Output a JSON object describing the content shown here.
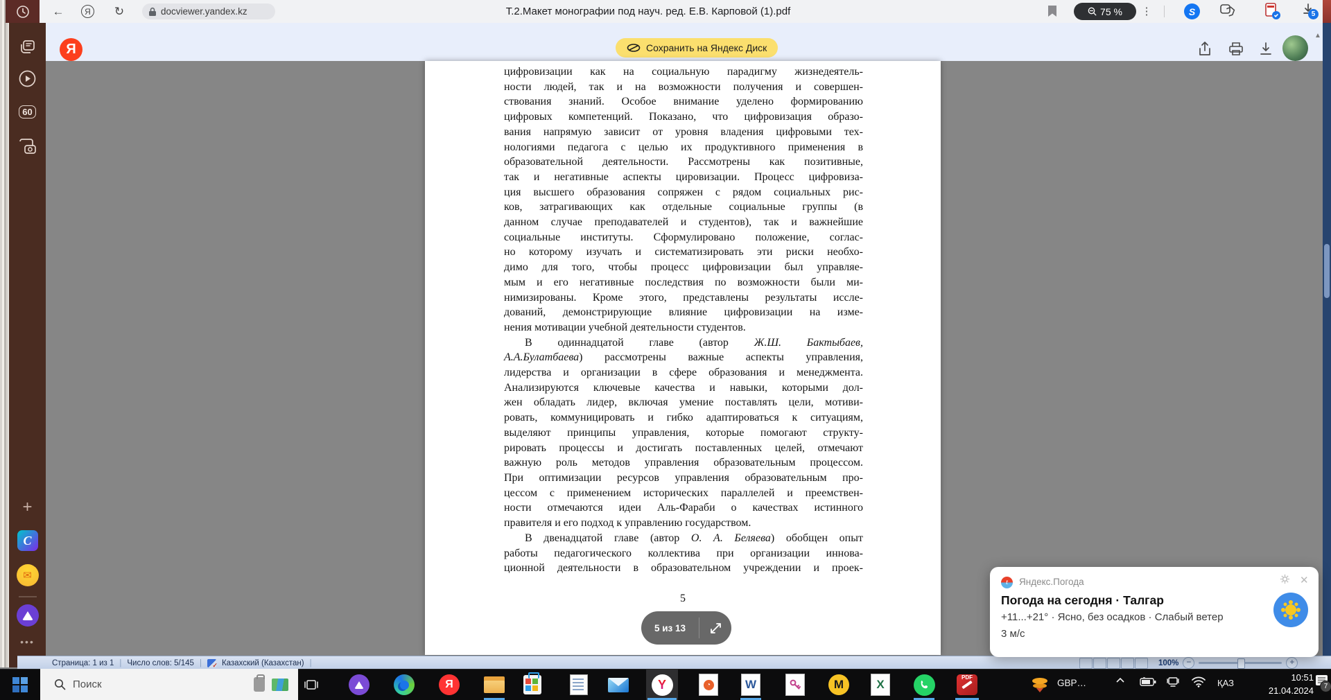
{
  "browser": {
    "url": "docviewer.yandex.kz",
    "title": "Т.2.Макет монографии под науч. ред. Е.В. Карповой (1).pdf",
    "zoom_badge": "75 %",
    "download_badge": "5",
    "accent_yellow": "#fbdf6e",
    "sidebar_brown": "#4a2c21"
  },
  "actions": {
    "save_button": "Сохранить на Яндекс Диск"
  },
  "sidebar": {
    "timer_badge": "60"
  },
  "document": {
    "page_number": "5",
    "pager_label": "5 из 13",
    "lines": [
      {
        "j": true,
        "s": [
          {
            "t": "цифровизации  как на социальную парадигму жизнедеятель-"
          }
        ]
      },
      {
        "j": true,
        "s": [
          {
            "t": "ности людей, так и на возможности получения и совершен-"
          }
        ]
      },
      {
        "j": true,
        "s": [
          {
            "t": "ствования знаний. Особое внимание уделено формированию"
          }
        ]
      },
      {
        "j": true,
        "s": [
          {
            "t": "цифровых компетенций. Показано, что цифровизация образо-"
          }
        ]
      },
      {
        "j": true,
        "s": [
          {
            "t": "вания напрямую зависит от уровня владения цифровыми тех-"
          }
        ]
      },
      {
        "j": true,
        "s": [
          {
            "t": "нологиями педагога с целью их продуктивного применения в"
          }
        ]
      },
      {
        "j": true,
        "s": [
          {
            "t": "образовательной деятельности. Рассмотрены как позитивные,"
          }
        ]
      },
      {
        "j": true,
        "s": [
          {
            "t": "так и негативные аспекты цировизации. Процесс цифровиза-"
          }
        ]
      },
      {
        "j": true,
        "s": [
          {
            "t": "ция высшего образования сопряжен с рядом социальных рис-"
          }
        ]
      },
      {
        "j": true,
        "s": [
          {
            "t": "ков, затрагивающих как отдельные социальные группы (в"
          }
        ]
      },
      {
        "j": true,
        "s": [
          {
            "t": "данном случае преподавателей и студентов), так и важнейшие"
          }
        ]
      },
      {
        "j": true,
        "s": [
          {
            "t": "социальные институты. Сформулировано положение, соглас-"
          }
        ]
      },
      {
        "j": true,
        "s": [
          {
            "t": "но которому изучать и систематизировать эти риски необхо-"
          }
        ]
      },
      {
        "j": true,
        "s": [
          {
            "t": "димо для того, чтобы процесс цифровизации был управляе-"
          }
        ]
      },
      {
        "j": true,
        "s": [
          {
            "t": "мым и его негативные последствия по возможности были ми-"
          }
        ]
      },
      {
        "j": true,
        "s": [
          {
            "t": "нимизированы. Кроме этого, представлены результаты иссле-"
          }
        ]
      },
      {
        "j": true,
        "s": [
          {
            "t": "дований, демонстрирующие влияние цифровизации на изме-"
          }
        ]
      },
      {
        "j": false,
        "s": [
          {
            "t": "нения мотивации учебной деятельности студентов."
          }
        ]
      },
      {
        "j": true,
        "ind": true,
        "s": [
          {
            "t": "В одиннадцатой главе (автор "
          },
          {
            "t": "Ж.Ш. Бактыбаев,",
            "i": true
          }
        ]
      },
      {
        "j": true,
        "s": [
          {
            "t": "А.А.Булатбаева",
            "i": true
          },
          {
            "t": ") рассмотрены важные аспекты управления,"
          }
        ]
      },
      {
        "j": true,
        "s": [
          {
            "t": "лидерства и организации в сфере образования и менеджмента."
          }
        ]
      },
      {
        "j": true,
        "s": [
          {
            "t": "Анализируются ключевые качества и навыки, которыми дол-"
          }
        ]
      },
      {
        "j": true,
        "s": [
          {
            "t": "жен обладать лидер, включая умение поставлять цели, мотиви-"
          }
        ]
      },
      {
        "j": true,
        "s": [
          {
            "t": "ровать, коммуницировать и гибко адаптироваться к ситуациям,"
          }
        ]
      },
      {
        "j": true,
        "s": [
          {
            "t": "выделяют принципы управления, которые помогают структу-"
          }
        ]
      },
      {
        "j": true,
        "s": [
          {
            "t": "рировать процессы и достигать поставленных целей, отмечают"
          }
        ]
      },
      {
        "j": true,
        "s": [
          {
            "t": "важную роль методов управления образовательным процессом."
          }
        ]
      },
      {
        "j": true,
        "s": [
          {
            "t": "При оптимизации ресурсов управления образовательным про-"
          }
        ]
      },
      {
        "j": true,
        "s": [
          {
            "t": "цессом с применением исторических параллелей и преемствен-"
          }
        ]
      },
      {
        "j": true,
        "s": [
          {
            "t": "ности отмечаются идеи Аль-Фараби о качествах истинного"
          }
        ]
      },
      {
        "j": false,
        "s": [
          {
            "t": "правителя и его подход к управлению государством."
          }
        ]
      },
      {
        "j": true,
        "ind": true,
        "s": [
          {
            "t": "В двенадцатой  главе (автор "
          },
          {
            "t": "О. А. Беляева",
            "i": true
          },
          {
            "t": ") обобщен опыт"
          }
        ]
      },
      {
        "j": true,
        "s": [
          {
            "t": "работы педагогического коллектива при организации иннова-"
          }
        ]
      },
      {
        "j": true,
        "s": [
          {
            "t": "ционной деятельности в образовательном учреждении и проек-"
          }
        ]
      }
    ]
  },
  "weather": {
    "app_name": "Яндекс.Погода",
    "title": "Погода на сегодня · Талгар",
    "line1": "+11...+21° · Ясно, без осадков · Слабый ветер",
    "line2": "3 м/с"
  },
  "wordbar": {
    "page": "Страница: 1 из 1",
    "words": "Число слов: 5/145",
    "lang": "Казахский (Казахстан)",
    "zoom": "100%"
  },
  "taskbar": {
    "search_placeholder": "Поиск",
    "tray_currency": "GBP…",
    "tray_lang": "ҚАЗ",
    "time": "10:51",
    "date": "21.04.2024",
    "notif_badge": "7"
  }
}
